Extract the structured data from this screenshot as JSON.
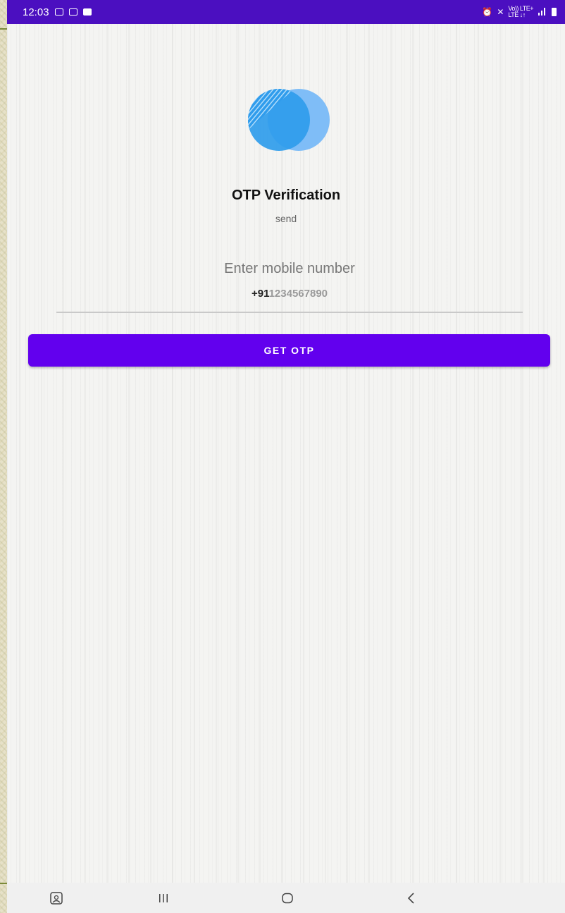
{
  "status_bar": {
    "time": "12:03",
    "left_icons": [
      "gallery-icon",
      "video-icon",
      "check-icon"
    ],
    "right_icons": [
      "alarm-icon",
      "mute-icon",
      "volte-lte-icon",
      "signal-icon",
      "battery-icon"
    ],
    "network_label_top": "Vo)) LTE+",
    "network_label_bottom": "LTE ↓↑"
  },
  "header": {
    "logo_icon": "overlapping-circles-logo",
    "title": "OTP Verification",
    "subtitle": "send"
  },
  "phone_field": {
    "hint": "Enter mobile number",
    "prefix": "+91",
    "number": "1234567890"
  },
  "actions": {
    "get_otp_label": "GET OTP"
  },
  "nav_bar": {
    "icons": [
      "screenshot-icon",
      "recents-icon",
      "home-icon",
      "back-icon"
    ]
  },
  "colors": {
    "status_bar": "#4b0fc0",
    "accent": "#6200ee",
    "logo_front": "#2f9cec",
    "logo_back": "#7fbdf7"
  }
}
